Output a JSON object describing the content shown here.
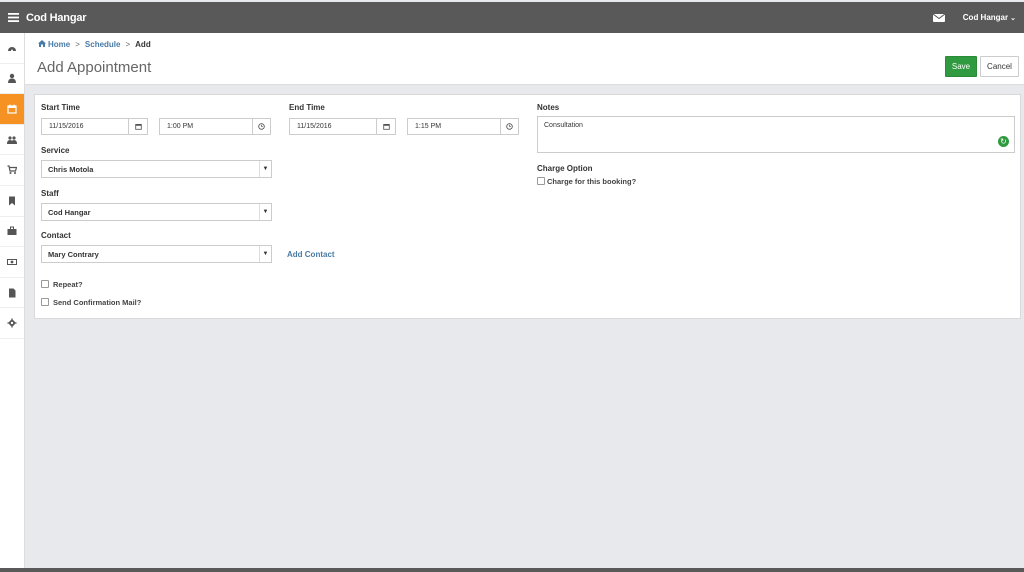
{
  "topbar": {
    "title": "Cod Hangar",
    "user": "Cod Hangar"
  },
  "sidebar": {
    "items": [
      "dashboard",
      "user",
      "calendar",
      "group",
      "cart",
      "bookmark",
      "briefcase",
      "money",
      "document",
      "settings"
    ],
    "active": "calendar",
    "accent": "#f59223"
  },
  "breadcrumb": {
    "home": "Home",
    "schedule": "Schedule",
    "current": "Add"
  },
  "page": {
    "title": "Add Appointment"
  },
  "actions": {
    "save": "Save",
    "cancel": "Cancel",
    "save_color": "#2f9a3f"
  },
  "form": {
    "start_time_label": "Start Time",
    "start_date": "11/15/2016",
    "start_time": "1:00 PM",
    "end_time_label": "End Time",
    "end_date": "11/15/2016",
    "end_time": "1:15 PM",
    "service_label": "Service",
    "service_value": "Chris Motola",
    "staff_label": "Staff",
    "staff_value": "Cod Hangar",
    "contact_label": "Contact",
    "contact_value": "Mary Contrary",
    "add_contact": "Add Contact",
    "repeat_label": "Repeat?",
    "confirm_label": "Send Confirmation Mail?",
    "notes_label": "Notes",
    "notes_value": "Consultation",
    "charge_option_label": "Charge Option",
    "charge_checkbox_label": "Charge for this booking?"
  }
}
